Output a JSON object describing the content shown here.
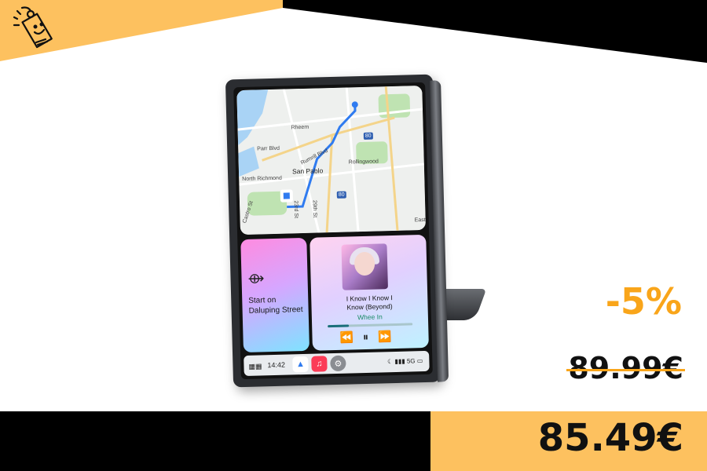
{
  "colors": {
    "accent_yellow": "#f9a51a",
    "banner_peach": "#fdc15f",
    "black": "#000000",
    "white": "#ffffff"
  },
  "logo_icon": "price-tag-smiley-icon",
  "product": {
    "screen": {
      "map_labels": [
        "Rheem",
        "Parr Blvd",
        "Rumrill Blvd",
        "San Pablo",
        "Rollingwood",
        "North Richmond",
        "23rd St",
        "29th St",
        "Castro St",
        "East"
      ],
      "highway_shields": [
        "80",
        "80"
      ],
      "nav_card": {
        "line1": "Start on",
        "line2": "Daluping Street"
      },
      "music_card": {
        "song_title_line1": "I Know I Know I",
        "song_title_line2": "Know (Beyond)",
        "artist": "Whee In",
        "progress": 0.25
      },
      "dock": {
        "time": "14:42",
        "network": "5G"
      }
    }
  },
  "pricing": {
    "discount": "-5%",
    "old_price": "89.99€",
    "new_price": "85.49€"
  }
}
